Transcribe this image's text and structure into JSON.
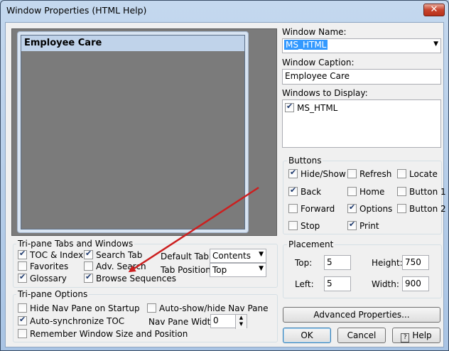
{
  "window": {
    "title": "Window Properties (HTML Help)",
    "close_glyph": "✕"
  },
  "preview": {
    "caption": "Employee Care"
  },
  "right": {
    "window_name_label": "Window Name:",
    "window_name_value": "MS_HTML",
    "window_caption_label": "Window Caption:",
    "window_caption_value": "Employee Care",
    "windows_to_display_label": "Windows to Display:",
    "windows_to_display_item": "MS_HTML"
  },
  "buttons_group": {
    "title": "Buttons",
    "items": [
      {
        "label": "Hide/Show",
        "checked": true
      },
      {
        "label": "Refresh",
        "checked": false
      },
      {
        "label": "Locate",
        "checked": false
      },
      {
        "label": "Back",
        "checked": true
      },
      {
        "label": "Home",
        "checked": false
      },
      {
        "label": "Button 1",
        "checked": false
      },
      {
        "label": "Forward",
        "checked": false
      },
      {
        "label": "Options",
        "checked": true
      },
      {
        "label": "Button 2",
        "checked": false
      },
      {
        "label": "Stop",
        "checked": false
      },
      {
        "label": "Print",
        "checked": true
      }
    ]
  },
  "placement": {
    "title": "Placement",
    "top_label": "Top:",
    "top_value": "5",
    "height_label": "Height:",
    "height_value": "750",
    "left_label": "Left:",
    "left_value": "5",
    "width_label": "Width:",
    "width_value": "900"
  },
  "tabs_group": {
    "title": "Tri-pane Tabs and Windows",
    "toc_index": "TOC & Index",
    "search_tab": "Search Tab",
    "favorites": "Favorites",
    "adv_search": "Adv. Search",
    "glossary": "Glossary",
    "browse_sequences": "Browse Sequences",
    "default_tab_label": "Default Tab:",
    "default_tab_value": "Contents",
    "tab_position_label": "Tab Position:",
    "tab_position_value": "Top"
  },
  "options_group": {
    "title": "Tri-pane Options",
    "hide_nav": "Hide Nav Pane on Startup",
    "auto_show_hide": "Auto-show/hide Nav Pane",
    "auto_sync": "Auto-synchronize TOC",
    "nav_width_label": "Nav Pane Width:",
    "nav_width_value": "0",
    "remember": "Remember Window Size and Position"
  },
  "footer": {
    "advanced": "Advanced Properties...",
    "ok": "OK",
    "cancel": "Cancel",
    "help": "Help",
    "help_glyph": "?"
  },
  "colors": {
    "arrow": "#cc1f1f",
    "selection": "#3399ff"
  }
}
